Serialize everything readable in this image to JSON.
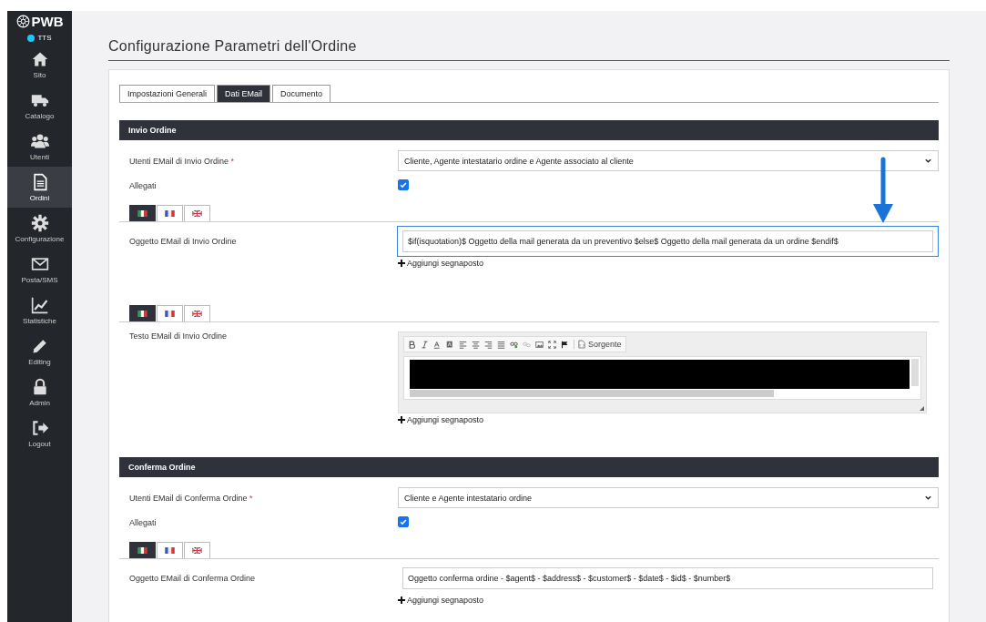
{
  "sidebar": {
    "logo": "PWB",
    "status": "TTS",
    "items": [
      {
        "label": "Sito",
        "selected": false
      },
      {
        "label": "Catalogo",
        "selected": false
      },
      {
        "label": "Utenti",
        "selected": false
      },
      {
        "label": "Ordini",
        "selected": true
      },
      {
        "label": "Configurazione",
        "selected": false
      },
      {
        "label": "Posta/SMS",
        "selected": false
      },
      {
        "label": "Statistiche",
        "selected": false
      },
      {
        "label": "Editing",
        "selected": false
      },
      {
        "label": "Admin",
        "selected": false
      },
      {
        "label": "Logout",
        "selected": false
      }
    ]
  },
  "page_title": "Configurazione Parametri dell'Ordine",
  "tabs": [
    {
      "label": "Impostazioni Generali",
      "selected": false
    },
    {
      "label": "Dati EMail",
      "selected": true
    },
    {
      "label": "Documento",
      "selected": false
    }
  ],
  "sections": [
    {
      "title": "Invio Ordine",
      "fields": [
        {
          "kind": "select",
          "label": "Utenti EMail di Invio Ordine",
          "required_mark": "*",
          "value": "Cliente, Agente intestatario ordine e Agente associato al cliente"
        },
        {
          "kind": "checkbox",
          "label": "Allegati",
          "checked": true
        },
        {
          "kind": "flags",
          "flags": [
            {
              "selected": true
            },
            {
              "selected": false
            },
            {
              "selected": false
            }
          ]
        },
        {
          "kind": "text",
          "label": "Oggetto EMail di Invio Ordine",
          "focused": true,
          "value": "$if(isquotation)$ Oggetto della mail generata da un preventivo $else$ Oggetto della mail generata da un ordine $endif$",
          "action": "Aggiungi segnaposto"
        },
        {
          "kind": "flags",
          "flags": [
            {
              "selected": true
            },
            {
              "selected": false
            },
            {
              "selected": false
            }
          ]
        },
        {
          "kind": "editor",
          "label": "Testo EMail di Invio Ordine",
          "source": "Sorgente",
          "action": "Aggiungi segnaposto"
        }
      ]
    },
    {
      "title": "Conferma Ordine",
      "fields": [
        {
          "kind": "select",
          "label": "Utenti EMail di Conferma Ordine",
          "required_mark": "*",
          "value": "Cliente e Agente intestatario ordine"
        },
        {
          "kind": "checkbox",
          "label": "Allegati",
          "checked": true
        },
        {
          "kind": "flags",
          "flags": [
            {
              "selected": true
            },
            {
              "selected": false
            },
            {
              "selected": false
            }
          ]
        },
        {
          "kind": "text",
          "label": "Oggetto EMail di Conferma Ordine",
          "focused": false,
          "value": "Oggetto conferma ordine - $agent$ - $address$ - $customer$ - $date$ - $id$ - $number$",
          "action": "Aggiungi segnaposto"
        }
      ]
    }
  ]
}
